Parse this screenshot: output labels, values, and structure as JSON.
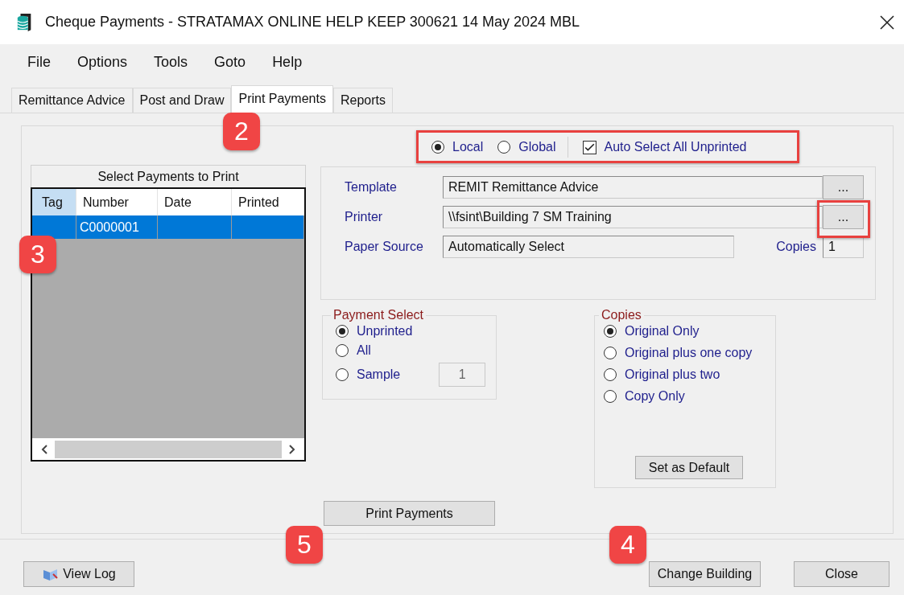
{
  "window": {
    "title": "Cheque Payments - STRATAMAX ONLINE HELP KEEP 300621 14 May 2024 MBL"
  },
  "menu": [
    "File",
    "Options",
    "Tools",
    "Goto",
    "Help"
  ],
  "tabs": [
    {
      "label": "Remittance Advice",
      "selected": false
    },
    {
      "label": "Post and Draw",
      "selected": false
    },
    {
      "label": "Print Payments",
      "selected": true
    },
    {
      "label": "Reports",
      "selected": false
    }
  ],
  "scope_options": [
    {
      "label": "Local",
      "selected": true
    },
    {
      "label": "Global",
      "selected": false
    }
  ],
  "auto_select": {
    "label": "Auto Select All Unprinted",
    "checked": true
  },
  "payments_list": {
    "title": "Select Payments to Print",
    "columns": [
      "Tag",
      "Number",
      "Date",
      "Printed"
    ],
    "rows": [
      {
        "number": "C0000001",
        "selected": true
      }
    ]
  },
  "settings": {
    "template": {
      "label": "Template",
      "value": "REMIT Remittance Advice",
      "button": "..."
    },
    "printer": {
      "label": "Printer",
      "value": "\\\\fsint\\Building 7 SM Training",
      "button": "..."
    },
    "paper_source": {
      "label": "Paper Source",
      "value": "Automatically Select"
    },
    "copies": {
      "label": "Copies",
      "value": "1"
    }
  },
  "payment_select": {
    "title": "Payment Select",
    "options": [
      {
        "label": "Unprinted",
        "selected": true
      },
      {
        "label": "All",
        "selected": false
      },
      {
        "label": "Sample",
        "selected": false
      }
    ],
    "sample_count": "1"
  },
  "copies_group": {
    "title": "Copies",
    "options": [
      {
        "label": "Original Only",
        "selected": true
      },
      {
        "label": "Original plus one copy",
        "selected": false
      },
      {
        "label": "Original plus two",
        "selected": false
      },
      {
        "label": "Copy Only",
        "selected": false
      }
    ],
    "button": "Set as Default"
  },
  "print_button": "Print Payments",
  "footer": {
    "view_log": "View Log",
    "change_building": "Change Building",
    "close": "Close"
  },
  "callouts": [
    "2",
    "3",
    "5",
    "4"
  ]
}
